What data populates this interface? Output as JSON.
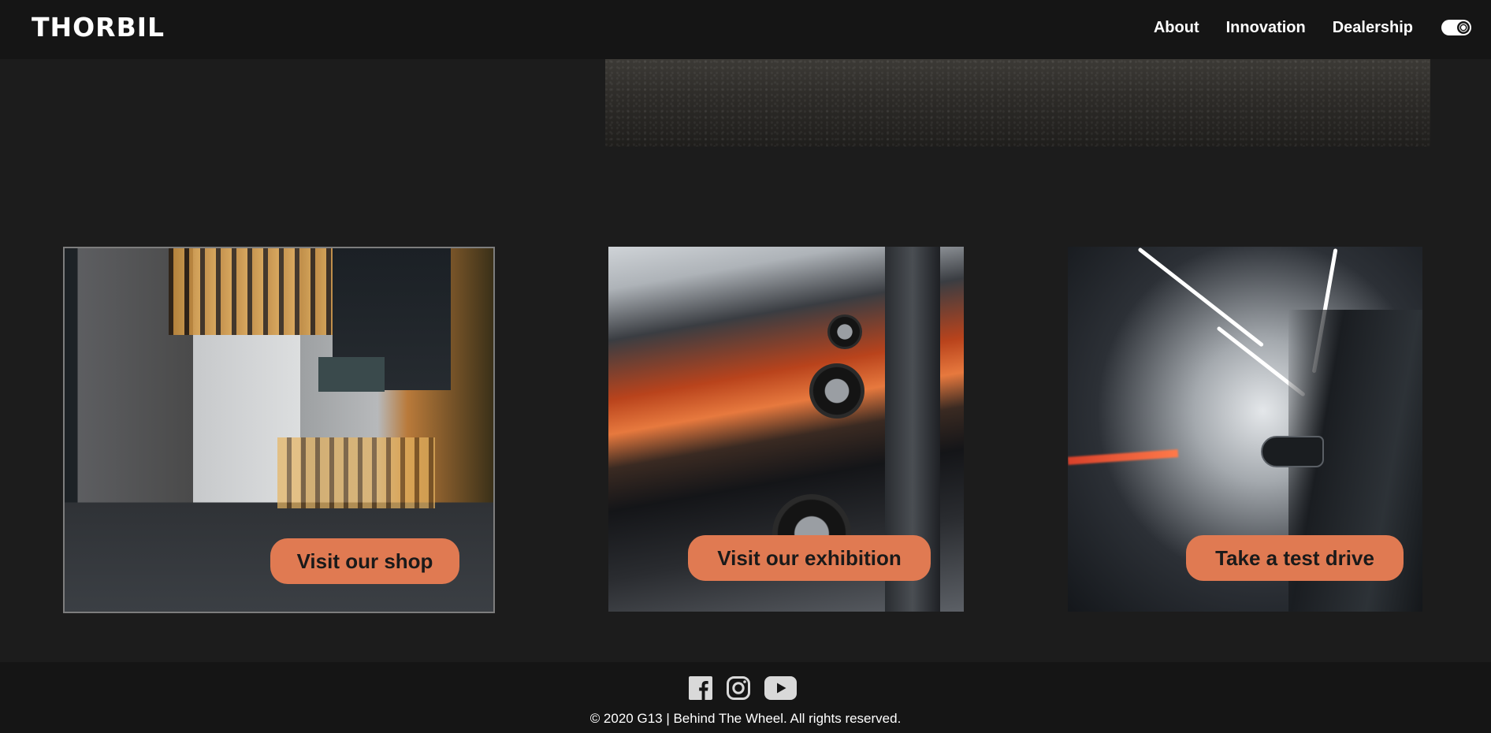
{
  "header": {
    "logo": "THORBIL",
    "nav": [
      {
        "label": "About"
      },
      {
        "label": "Innovation"
      },
      {
        "label": "Dealership"
      }
    ],
    "theme_toggle_icon": "sun-toggle-icon"
  },
  "cards": [
    {
      "button_label": "Visit our shop"
    },
    {
      "button_label": "Visit our exhibition"
    },
    {
      "button_label": "Take a test drive"
    }
  ],
  "footer": {
    "social_icons": [
      "facebook-icon",
      "instagram-icon",
      "youtube-icon"
    ],
    "copyright": "© 2020 G13 | Behind The Wheel. All rights reserved."
  },
  "colors": {
    "background": "#1c1c1c",
    "bars": "#151515",
    "accent": "#e07a52",
    "text": "#ffffff"
  }
}
